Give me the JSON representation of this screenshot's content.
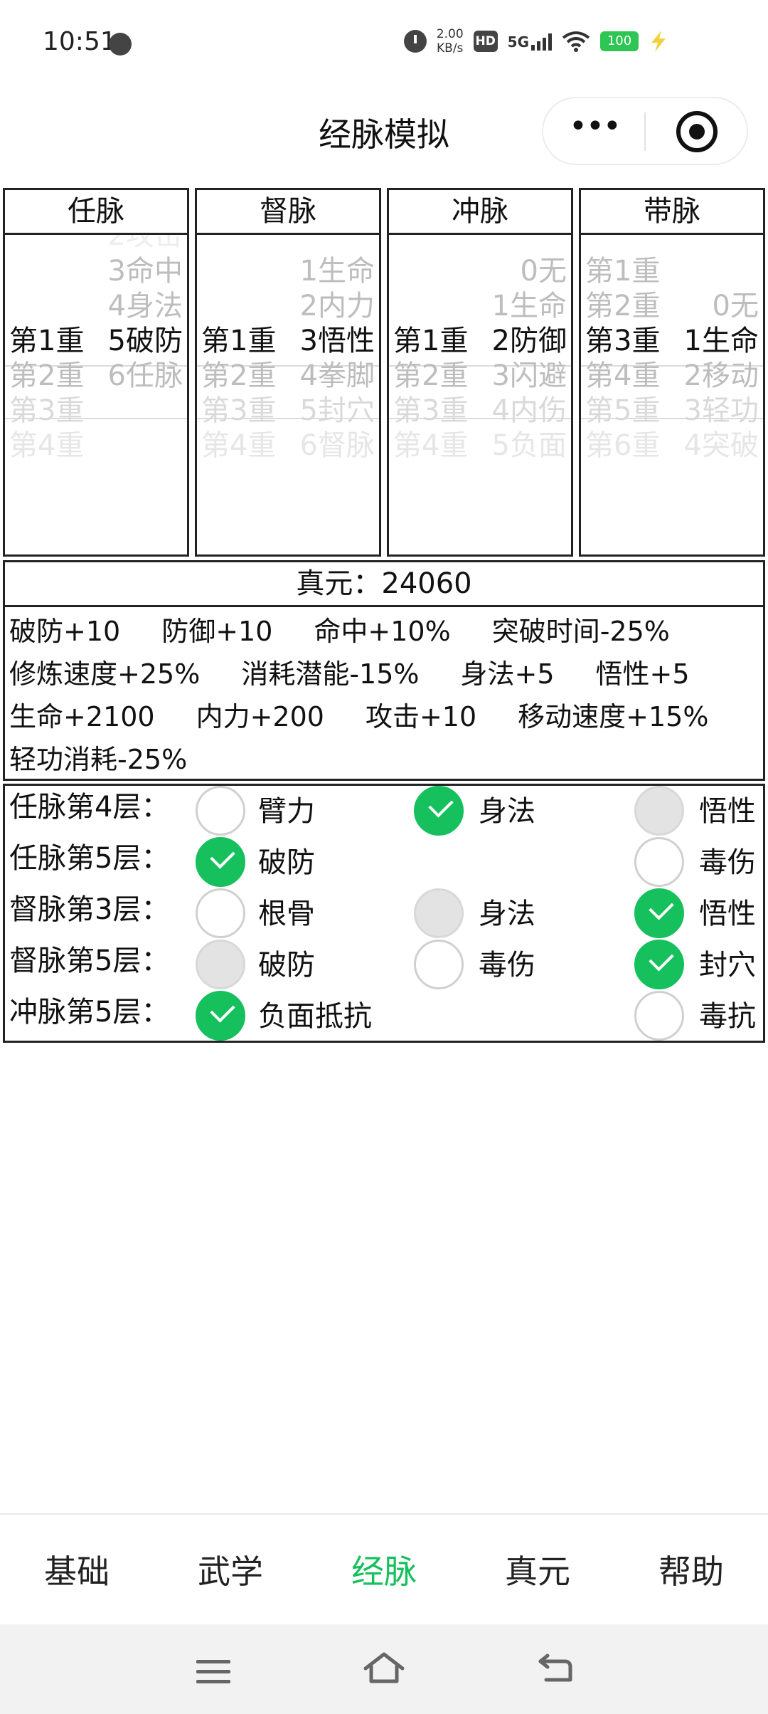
{
  "status": {
    "time": "10:51",
    "speed_value": "2.00",
    "speed_unit": "KB/s",
    "hd": "HD",
    "network": "5G",
    "battery": "100"
  },
  "nav": {
    "title": "经脉模拟",
    "more": "•••"
  },
  "meridians": [
    {
      "name": "任脉",
      "rows": [
        {
          "a": "",
          "b": "3命中"
        },
        {
          "a": "",
          "b": "4身法"
        },
        {
          "a": "第1重",
          "b": "5破防"
        },
        {
          "a": "第2重",
          "b": "6任脉"
        },
        {
          "a": "第3重",
          "b": ""
        },
        {
          "a": "第4重",
          "b": ""
        }
      ]
    },
    {
      "name": "督脉",
      "rows": [
        {
          "a": "",
          "b": "1生命"
        },
        {
          "a": "",
          "b": "2内力"
        },
        {
          "a": "第1重",
          "b": "3悟性"
        },
        {
          "a": "第2重",
          "b": "4拳脚"
        },
        {
          "a": "第3重",
          "b": "5封穴"
        },
        {
          "a": "第4重",
          "b": "6督脉"
        }
      ]
    },
    {
      "name": "冲脉",
      "rows": [
        {
          "a": "",
          "b": "0无"
        },
        {
          "a": "",
          "b": "1生命"
        },
        {
          "a": "第1重",
          "b": "2防御"
        },
        {
          "a": "第2重",
          "b": "3闪避"
        },
        {
          "a": "第3重",
          "b": "4内伤"
        },
        {
          "a": "第4重",
          "b": "5负面"
        }
      ]
    },
    {
      "name": "带脉",
      "rows": [
        {
          "a": "第1重",
          "b": ""
        },
        {
          "a": "第2重",
          "b": "0无"
        },
        {
          "a": "第3重",
          "b": "1生命"
        },
        {
          "a": "第4重",
          "b": "2移动"
        },
        {
          "a": "第5重",
          "b": "3轻功"
        },
        {
          "a": "第6重",
          "b": "4突破"
        }
      ]
    }
  ],
  "zhenyuan": {
    "title": "真元：24060",
    "lines": [
      [
        "破防+10",
        "防御+10",
        "命中+10%",
        "突破时间-25%"
      ],
      [
        "修炼速度+25%",
        "消耗潜能-15%",
        "身法+5",
        "悟性+5"
      ],
      [
        "生命+2100",
        "内力+200",
        "攻击+10",
        "移动速度+15%"
      ],
      [
        "轻功消耗-25%"
      ]
    ]
  },
  "options": [
    {
      "label": "任脉第4层：",
      "choices": [
        {
          "text": "臂力",
          "state": "unchecked"
        },
        {
          "text": "身法",
          "state": "checked"
        },
        {
          "text": "悟性",
          "state": "disabled"
        }
      ]
    },
    {
      "label": "任脉第5层：",
      "choices": [
        {
          "text": "破防",
          "state": "checked"
        },
        null,
        {
          "text": "毒伤",
          "state": "unchecked"
        }
      ]
    },
    {
      "label": "督脉第3层：",
      "choices": [
        {
          "text": "根骨",
          "state": "unchecked"
        },
        {
          "text": "身法",
          "state": "disabled"
        },
        {
          "text": "悟性",
          "state": "checked"
        }
      ]
    },
    {
      "label": "督脉第5层：",
      "choices": [
        {
          "text": "破防",
          "state": "disabled"
        },
        {
          "text": "毒伤",
          "state": "unchecked"
        },
        {
          "text": "封穴",
          "state": "checked"
        }
      ]
    },
    {
      "label": "冲脉第5层：",
      "choices": [
        {
          "text": "负面抵抗",
          "state": "checked"
        },
        null,
        {
          "text": "毒抗",
          "state": "unchecked"
        }
      ]
    }
  ],
  "tabs": [
    {
      "label": "基础",
      "active": false
    },
    {
      "label": "武学",
      "active": false
    },
    {
      "label": "经脉",
      "active": true
    },
    {
      "label": "真元",
      "active": false
    },
    {
      "label": "帮助",
      "active": false
    }
  ],
  "colors": {
    "accent": "#15c05d",
    "battery": "#2dc653"
  }
}
